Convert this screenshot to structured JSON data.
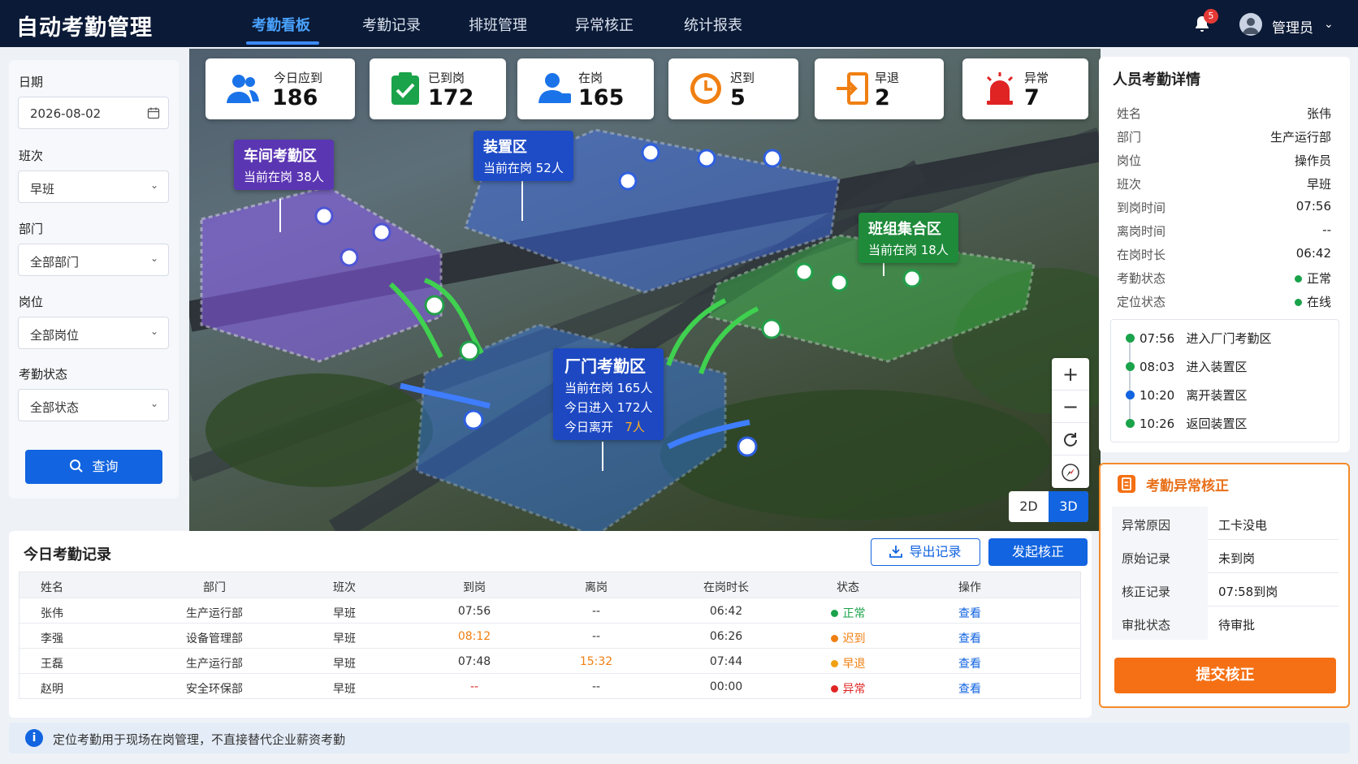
{
  "app": {
    "title": "自动考勤管理"
  },
  "nav": {
    "tabs": [
      "考勤看板",
      "考勤记录",
      "排班管理",
      "异常核正",
      "统计报表"
    ],
    "active": "考勤看板"
  },
  "header": {
    "notification_count": "5",
    "user_name": "管理员"
  },
  "filters": {
    "date_label": "日期",
    "date_value": "2026-08-02",
    "shift_label": "班次",
    "shift_value": "早班",
    "dept_label": "部门",
    "dept_value": "全部部门",
    "post_label": "岗位",
    "post_value": "全部岗位",
    "status_label": "考勤状态",
    "status_value": "全部状态",
    "query_label": "查询"
  },
  "stats": [
    {
      "label": "今日应到",
      "value": "186",
      "icon": "users-icon",
      "color": "#1a73e8"
    },
    {
      "label": "已到岗",
      "value": "172",
      "icon": "check-clipboard-icon",
      "color": "#1aa34a"
    },
    {
      "label": "在岗",
      "value": "165",
      "icon": "user-icon",
      "color": "#1a73e8"
    },
    {
      "label": "迟到",
      "value": "5",
      "icon": "clock-icon",
      "color": "#f07f12"
    },
    {
      "label": "早退",
      "value": "2",
      "icon": "exit-icon",
      "color": "#f07f12"
    },
    {
      "label": "异常",
      "value": "7",
      "icon": "alarm-icon",
      "color": "#e02424"
    }
  ],
  "zones": {
    "workshop": {
      "title": "车间考勤区",
      "sub": "当前在岗 38人"
    },
    "device": {
      "title": "装置区",
      "sub": "当前在岗 52人"
    },
    "team": {
      "title": "班组集合区",
      "sub": "当前在岗 18人"
    },
    "gate": {
      "title": "厂门考勤区",
      "line1": "当前在岗 165人",
      "line2": "今日进入 172人",
      "line3_label": "今日离开",
      "line3_value": "7人"
    }
  },
  "map_controls": {
    "zoom_in": "+",
    "zoom_out": "−",
    "view_2d": "2D",
    "view_3d": "3D"
  },
  "detail": {
    "title": "人员考勤详情",
    "rows": [
      {
        "k": "姓名",
        "v": "张伟"
      },
      {
        "k": "部门",
        "v": "生产运行部"
      },
      {
        "k": "岗位",
        "v": "操作员"
      },
      {
        "k": "班次",
        "v": "早班"
      },
      {
        "k": "到岗时间",
        "v": "07:56"
      },
      {
        "k": "离岗时间",
        "v": "--"
      },
      {
        "k": "在岗时长",
        "v": "06:42"
      },
      {
        "k": "考勤状态",
        "v": "正常"
      },
      {
        "k": "定位状态",
        "v": "在线"
      }
    ],
    "timeline": [
      {
        "time": "07:56",
        "event": "进入厂门考勤区",
        "color": "#1aa34a"
      },
      {
        "time": "08:03",
        "event": "进入装置区",
        "color": "#1aa34a"
      },
      {
        "time": "10:20",
        "event": "离开装置区",
        "color": "#1264e0"
      },
      {
        "time": "10:26",
        "event": "返回装置区",
        "color": "#1aa34a"
      }
    ]
  },
  "correction": {
    "title": "考勤异常核正",
    "rows": [
      {
        "k": "异常原因",
        "v": "工卡没电"
      },
      {
        "k": "原始记录",
        "v": "未到岗"
      },
      {
        "k": "核正记录",
        "v": "07:58到岗"
      },
      {
        "k": "审批状态",
        "v": "待审批"
      }
    ],
    "submit": "提交核正"
  },
  "records": {
    "title": "今日考勤记录",
    "export": "导出记录",
    "start": "发起核正",
    "columns": [
      "姓名",
      "部门",
      "班次",
      "到岗",
      "离岗",
      "在岗时长",
      "状态",
      "操作"
    ],
    "rows": [
      {
        "name": "张伟",
        "dept": "生产运行部",
        "shift": "早班",
        "arrive": "07:56",
        "leave": "--",
        "duration": "06:42",
        "status": "正常",
        "status_color": "#1aa34a",
        "action": "查看"
      },
      {
        "name": "李强",
        "dept": "设备管理部",
        "shift": "早班",
        "arrive": "08:12",
        "leave": "--",
        "duration": "06:26",
        "status": "迟到",
        "status_color": "#f07f12",
        "action": "查看"
      },
      {
        "name": "王磊",
        "dept": "生产运行部",
        "shift": "早班",
        "arrive": "07:48",
        "leave": "15:32",
        "duration": "07:44",
        "status": "早退",
        "status_color": "#f0a012",
        "action": "查看"
      },
      {
        "name": "赵明",
        "dept": "安全环保部",
        "shift": "早班",
        "arrive": "--",
        "leave": "--",
        "duration": "00:00",
        "status": "异常",
        "status_color": "#e02424",
        "action": "查看"
      }
    ]
  },
  "info": {
    "text": "定位考勤用于现场在岗管理，不直接替代企业薪资考勤"
  }
}
